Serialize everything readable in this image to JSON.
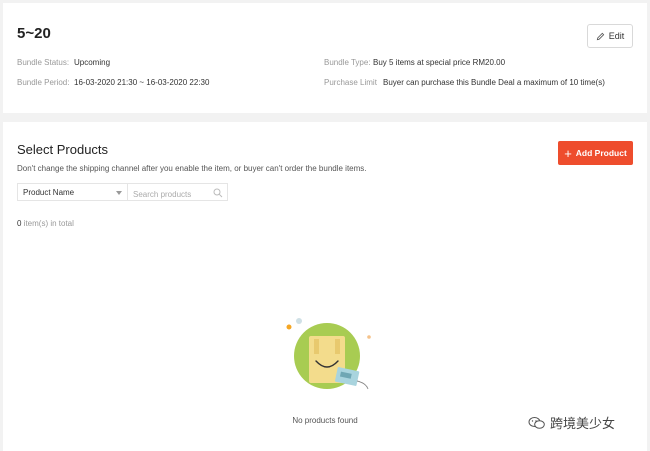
{
  "bundle": {
    "title": "5~20",
    "edit_label": "Edit",
    "status_label": "Bundle Status:",
    "status_value": "Upcoming",
    "period_label": "Bundle Period:",
    "period_value": "16-03-2020 21:30 ~ 16-03-2020 22:30",
    "type_label": "Bundle Type:",
    "type_value": "Buy 5 items at special price RM20.00",
    "limit_label": "Purchase Limit",
    "limit_value": "Buyer can purchase this Bundle Deal a maximum of 10 time(s)"
  },
  "products": {
    "title": "Select Products",
    "note": "Don't change the shipping channel after you enable the item, or buyer can't order the bundle items.",
    "add_label": "Add Product",
    "filter_selected": "Product Name",
    "search_placeholder": "Search products",
    "count_value": "0",
    "count_suffix": " item(s) in total",
    "empty_text": "No products found"
  },
  "watermark": {
    "text": "跨境美少女",
    "icon": "wechat-icon"
  },
  "colors": {
    "accent": "#ee4d2d",
    "illustration_green": "#a8cc52",
    "illustration_bag": "#f3dc8c"
  }
}
